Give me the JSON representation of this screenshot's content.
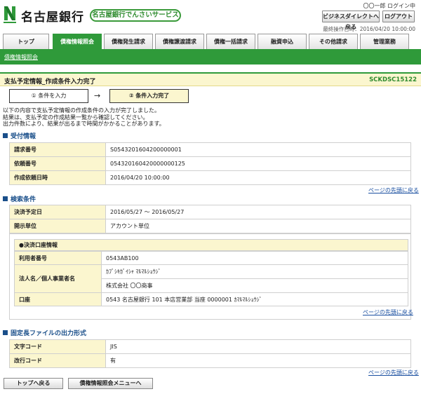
{
  "header": {
    "bank_name": "名古屋銀行",
    "service_name": "名古屋銀行でんさいサービス",
    "login_user": "〇〇一郎 ログイン中",
    "btn_bizdirect": "ビジネスダイレクトへ戻る",
    "btn_logout": "ログアウト",
    "last_operation": "最終操作日時：2016/04/20 10:00:00"
  },
  "tabs": [
    "トップ",
    "債権情報照会",
    "債権発生請求",
    "債権譲渡請求",
    "債権一括請求",
    "融資申込",
    "その他請求",
    "管理業務"
  ],
  "subnav": {
    "link": "債権情報照会"
  },
  "page": {
    "title": "支払予定情報_作成条件入力完了",
    "screen_id": "SCKDSC15122"
  },
  "steps": {
    "step1": "① 条件を入力",
    "arrow": "→",
    "step2": "② 条件入力完了"
  },
  "message": {
    "line1": "以下の内容で支払予定情報の作成条件の入力が完了しました。",
    "line2": "結果は、支払予定の作成結果一覧から確認してください。",
    "line3": "出力件数により、結果が出るまで時間がかかることがあります。"
  },
  "reception": {
    "title": "受付情報",
    "rows": [
      {
        "label": "請求番号",
        "value": "S0543201604200000001"
      },
      {
        "label": "依頼番号",
        "value": "054320160420000000125"
      },
      {
        "label": "作成依頼日時",
        "value": "2016/04/20 10:00:00"
      }
    ]
  },
  "page_top": "ページの先頭に戻る",
  "search": {
    "title": "検索条件",
    "rows": [
      {
        "label": "決済予定日",
        "value": "2016/05/27 ～ 2016/05/27"
      },
      {
        "label": "開示単位",
        "value": "アカウント単位"
      }
    ],
    "account": {
      "heading": "●決済口座情報",
      "user_no_label": "利用者番号",
      "user_no": "0543AB100",
      "name_label": "法人名／個人事業者名",
      "name_kana": "ｶﾌﾞｼｷｶﾞｲｼｬ ﾏﾙﾏﾙｼｮｳｼﾞ",
      "name_kanji": "株式会社 〇〇商事",
      "account_label": "口座",
      "account_value": "0543 名古屋銀行 101 本店営業部 当座 0000001 ｶﾏﾙﾏﾙｼｮｳｼﾞ"
    }
  },
  "fixed_file": {
    "title": "固定長ファイルの出力形式",
    "rows": [
      {
        "label": "文字コード",
        "value": "JIS"
      },
      {
        "label": "改行コード",
        "value": "有"
      }
    ]
  },
  "bottom": {
    "btn_top": "トップへ戻る",
    "btn_menu": "債権情報照会メニューへ"
  },
  "colors": {
    "brand_green": "#2f9a3a",
    "label_bg": "#fbf6cf",
    "section_blue": "#1a4f8a"
  }
}
